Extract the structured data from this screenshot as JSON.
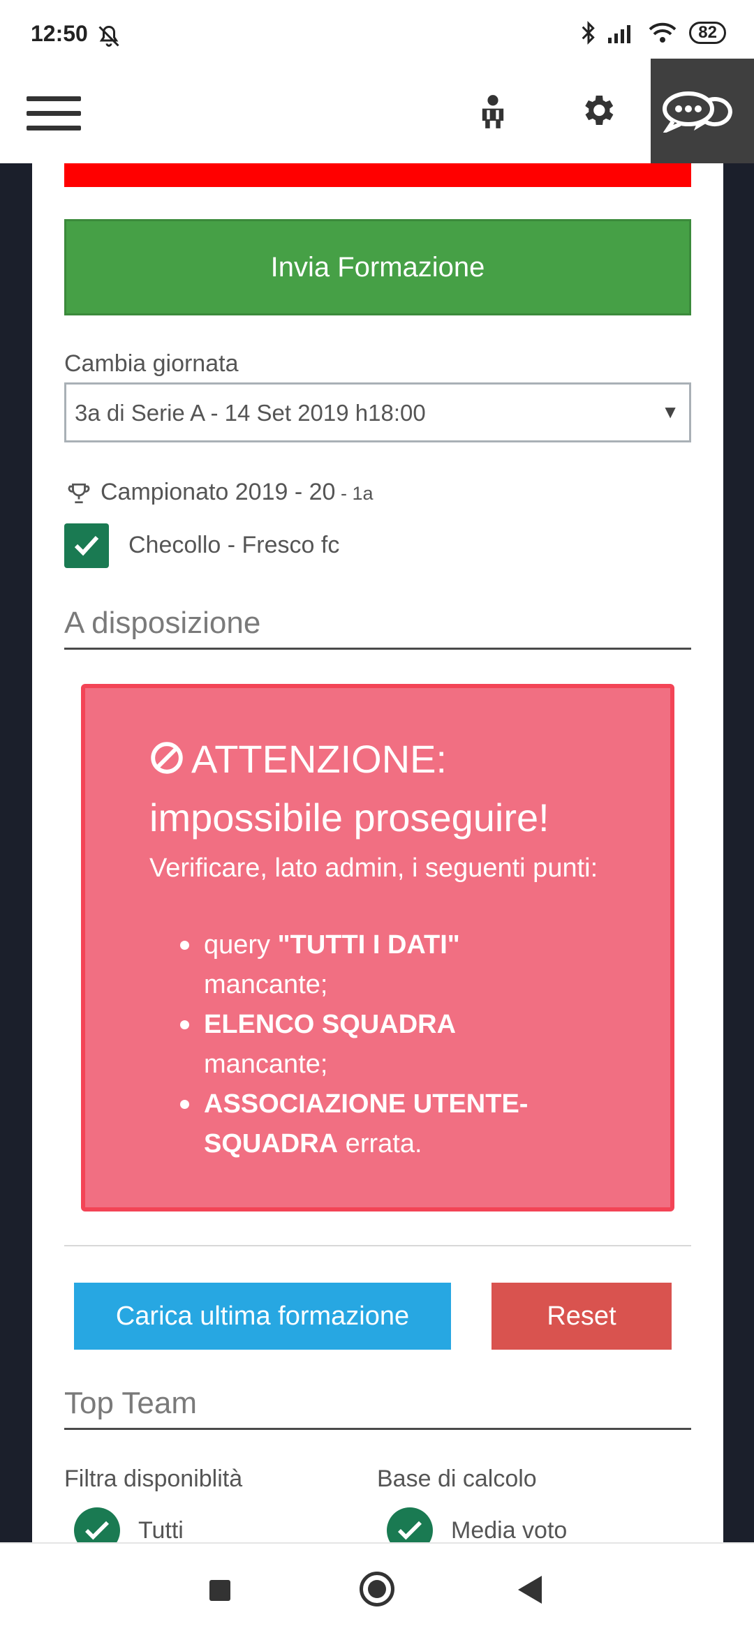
{
  "status_bar": {
    "time": "12:50",
    "battery": "82",
    "icons": [
      "bell-off-icon",
      "bluetooth-icon",
      "signal-icon",
      "wifi-icon",
      "battery-icon"
    ]
  },
  "header": {
    "icons": [
      "menu-icon",
      "user-icon",
      "gear-icon",
      "chat-icon"
    ]
  },
  "form": {
    "submit_label": "Invia Formazione",
    "change_round_label": "Cambia giornata",
    "round_select_value": "3a di Serie A - 14 Set 2019 h18:00",
    "championship": "Campionato 2019 - 20",
    "championship_suffix": " - 1a",
    "team_name": "Checollo - Fresco fc"
  },
  "available_section": {
    "title": "A disposizione"
  },
  "alert": {
    "title_part1": "ATTENZIONE:",
    "title_part2": "impossibile proseguire!",
    "intro": "Verificare, lato admin, i seguenti punti:",
    "items": [
      {
        "bold": "\"TUTTI I DATI\"",
        "prefix": "query ",
        "suffix": " mancante;"
      },
      {
        "bold": "ELENCO SQUADRA",
        "prefix": "",
        "suffix": " mancante;"
      },
      {
        "bold": "ASSOCIAZIONE UTENTE-SQUADRA",
        "prefix": "",
        "suffix": " errata."
      }
    ]
  },
  "actions": {
    "load_last_label": "Carica ultima formazione",
    "reset_label": "Reset"
  },
  "top_team": {
    "title": "Top Team",
    "filter_label": "Filtra disponiblità",
    "filter_option": "Tutti",
    "calc_label": "Base di calcolo",
    "calc_option": "Media voto"
  },
  "colors": {
    "submit": "#46a046",
    "alert_bg": "#f16f82",
    "load_btn": "#27a7e2",
    "reset_btn": "#d9534f",
    "check": "#1a7a52"
  }
}
